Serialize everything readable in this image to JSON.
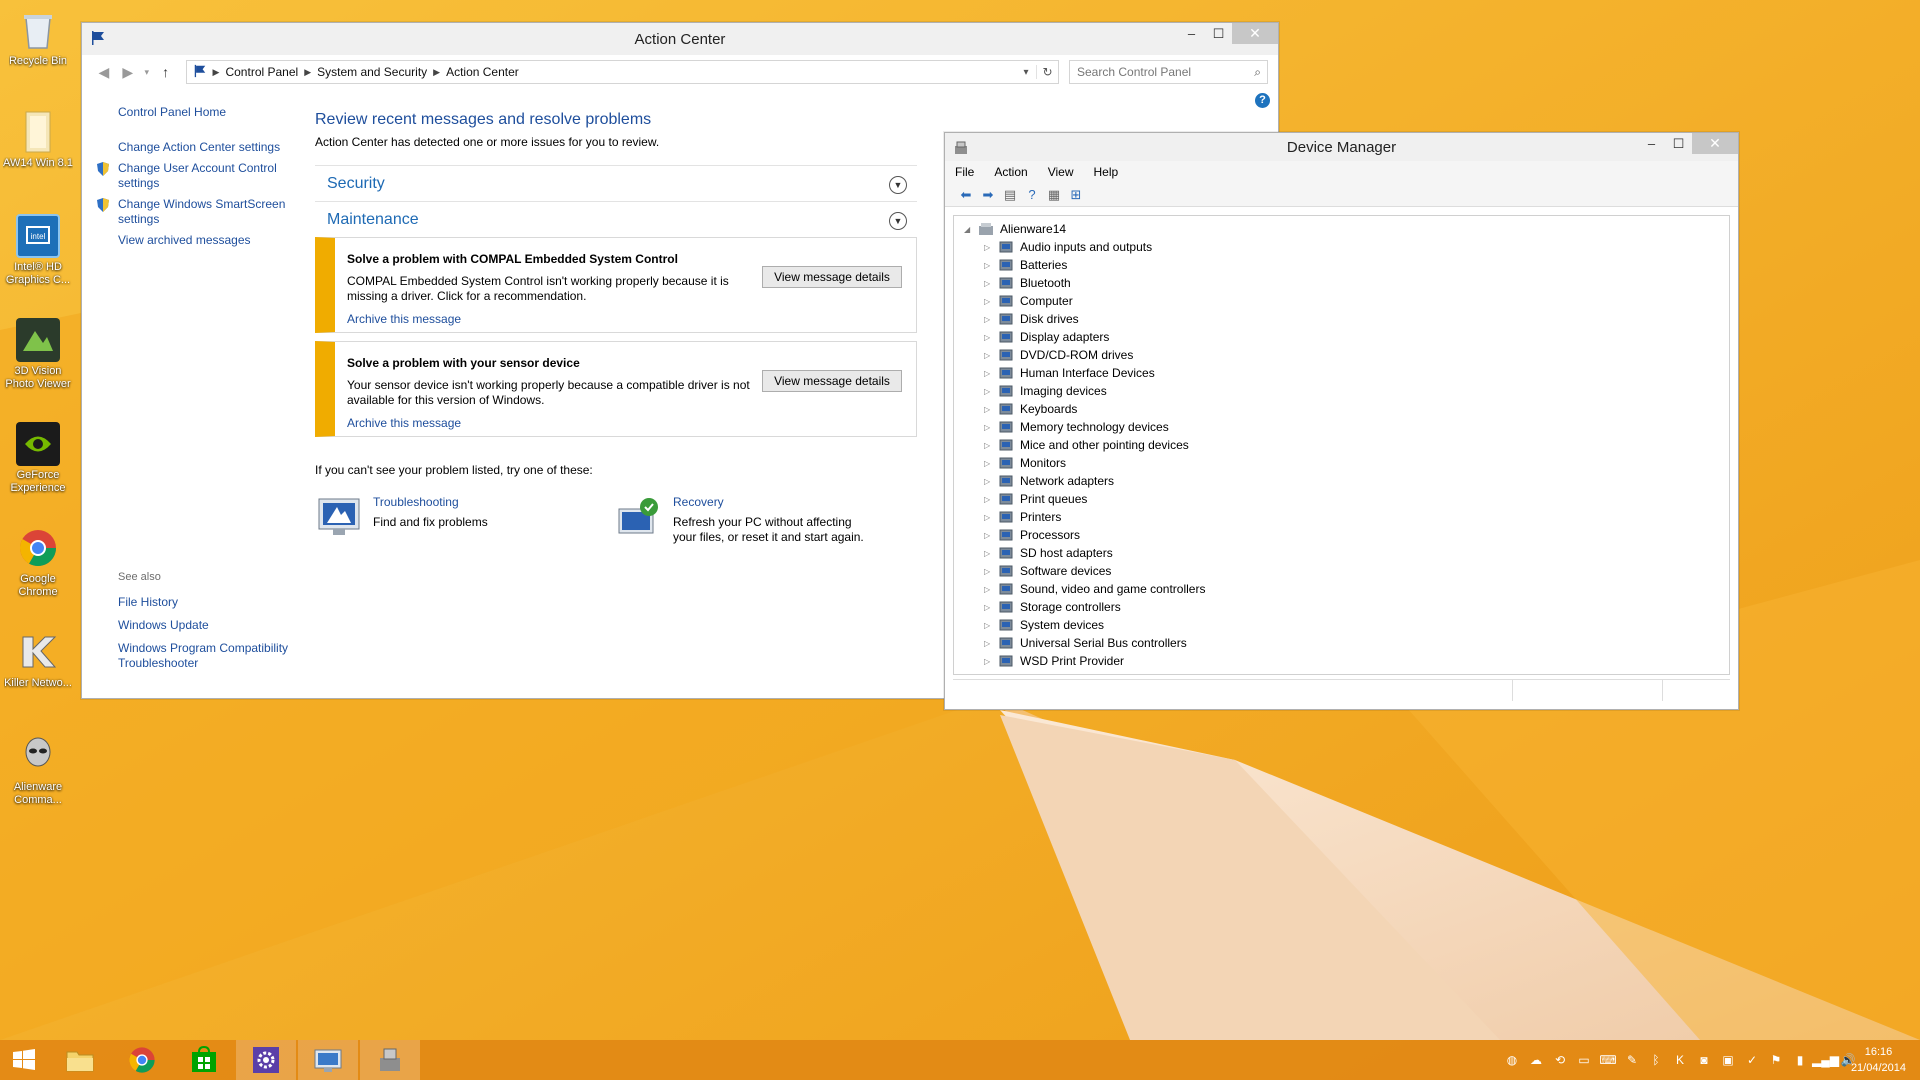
{
  "desktop": {
    "icons": [
      {
        "label": "Recycle Bin"
      },
      {
        "label": "AW14 Win 8.1"
      },
      {
        "label": "Intel® HD Graphics C..."
      },
      {
        "label": "3D Vision Photo Viewer"
      },
      {
        "label": "GeForce Experience"
      },
      {
        "label": "Google Chrome"
      },
      {
        "label": "Killer Netwo..."
      },
      {
        "label": "Alienware Comma..."
      }
    ]
  },
  "action_center": {
    "title": "Action Center",
    "breadcrumb": [
      "Control Panel",
      "System and Security",
      "Action Center"
    ],
    "search_placeholder": "Search Control Panel",
    "left_nav": {
      "home": "Control Panel Home",
      "links": [
        "Change Action Center settings",
        "Change User Account Control settings",
        "Change Windows SmartScreen settings",
        "View archived messages"
      ]
    },
    "see_also": {
      "header": "See also",
      "links": [
        "File History",
        "Windows Update",
        "Windows Program Compatibility Troubleshooter"
      ]
    },
    "heading": "Review recent messages and resolve problems",
    "subheading": "Action Center has detected one or more issues for you to review.",
    "sections": {
      "security": "Security",
      "maintenance": "Maintenance"
    },
    "messages": [
      {
        "title": "Solve a problem with COMPAL Embedded System Control",
        "body": "COMPAL Embedded System Control isn't working properly because it is missing a driver. Click for a recommendation.",
        "link": "Archive this message",
        "button": "View message details"
      },
      {
        "title": "Solve a problem with your sensor device",
        "body": "Your sensor device isn't working properly because a compatible driver is not available for this version of Windows.",
        "link": "Archive this message",
        "button": "View message details"
      }
    ],
    "try_line": "If you can't see your problem listed, try one of these:",
    "tools": [
      {
        "name": "Troubleshooting",
        "desc": "Find and fix problems"
      },
      {
        "name": "Recovery",
        "desc": "Refresh your PC without affecting your files, or reset it and start again."
      }
    ]
  },
  "device_manager": {
    "title": "Device Manager",
    "menu": [
      "File",
      "Action",
      "View",
      "Help"
    ],
    "root": "Alienware14",
    "nodes": [
      "Audio inputs and outputs",
      "Batteries",
      "Bluetooth",
      "Computer",
      "Disk drives",
      "Display adapters",
      "DVD/CD-ROM drives",
      "Human Interface Devices",
      "Imaging devices",
      "Keyboards",
      "Memory technology devices",
      "Mice and other pointing devices",
      "Monitors",
      "Network adapters",
      "Print queues",
      "Printers",
      "Processors",
      "SD host adapters",
      "Software devices",
      "Sound, video and game controllers",
      "Storage controllers",
      "System devices",
      "Universal Serial Bus controllers",
      "WSD Print Provider"
    ]
  },
  "taskbar": {
    "clock_time": "16:16",
    "clock_date": "21/04/2014"
  },
  "colors": {
    "accent": "#1e4e9c",
    "warning": "#f0ac00",
    "wallpaper": "#f0a21a"
  }
}
